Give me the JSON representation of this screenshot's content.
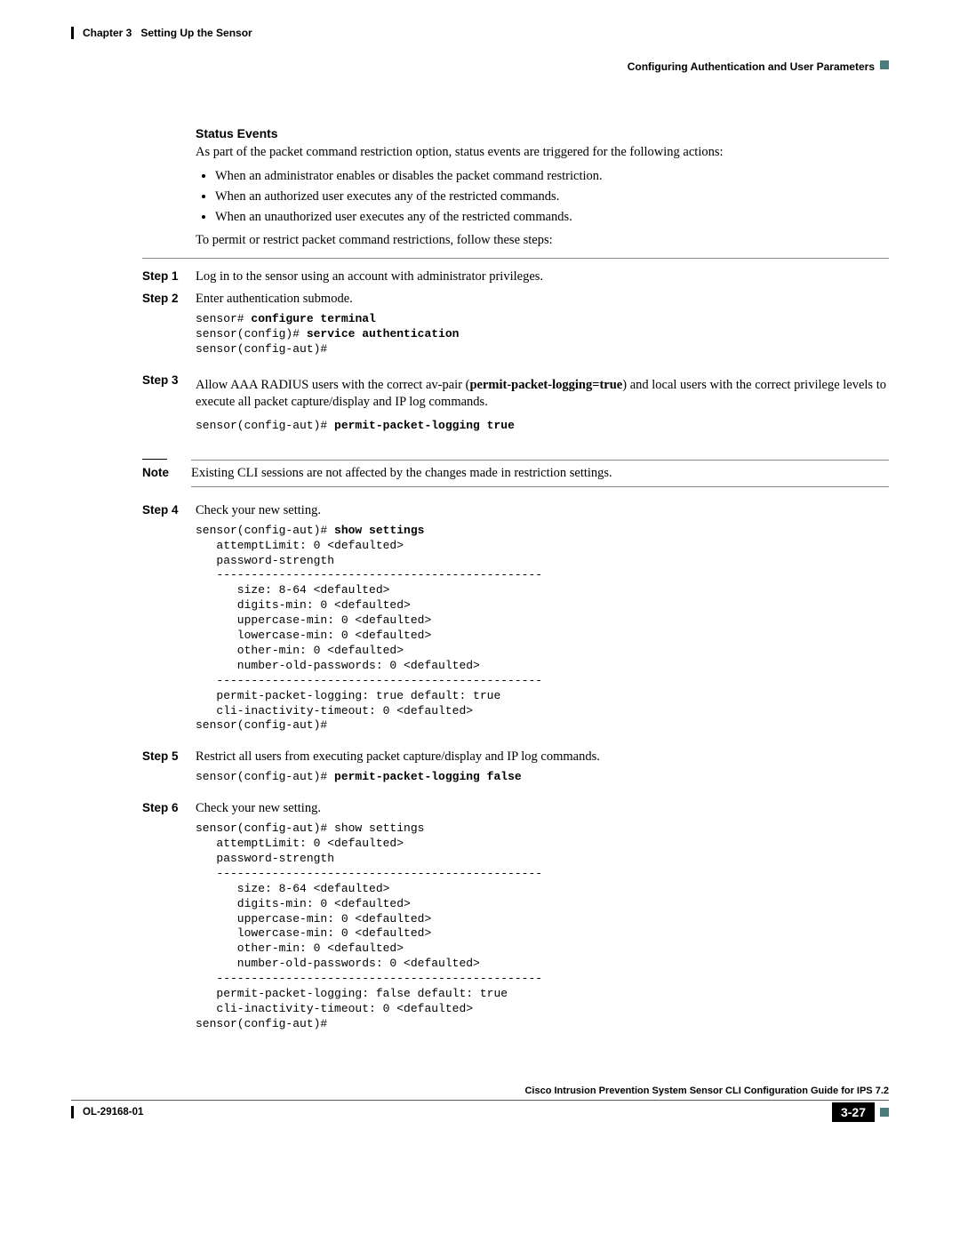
{
  "header": {
    "chapter": "Chapter 3",
    "title": "Setting Up the Sensor",
    "section": "Configuring Authentication and User Parameters"
  },
  "section": {
    "heading": "Status Events",
    "intro": "As part of the packet command restriction option, status events are triggered for the following actions:",
    "bullets": [
      "When an administrator enables or disables the packet command restriction.",
      "When an authorized user executes any of the restricted commands.",
      "When an unauthorized user executes any of the restricted commands."
    ],
    "lead": "To permit or restrict packet command restrictions, follow these steps:"
  },
  "steps": {
    "s1": {
      "label": "Step 1",
      "text": "Log in to the sensor using an account with administrator privileges."
    },
    "s2": {
      "label": "Step 2",
      "text": "Enter authentication submode.",
      "code": {
        "plain1": "sensor# ",
        "bold1": "configure terminal",
        "plain2": "\nsensor(config)# ",
        "bold2": "service authentication",
        "plain3": "\nsensor(config-aut)# "
      }
    },
    "s3": {
      "label": "Step 3",
      "text_pre": "Allow AAA RADIUS users with the correct av-pair (",
      "text_bold": "permit-packet-logging=true",
      "text_post": ") and local users with the correct privilege levels to execute all packet capture/display and IP log commands.",
      "code": {
        "plain1": "sensor(config-aut)# ",
        "bold1": "permit-packet-logging true"
      }
    },
    "note": {
      "label": "Note",
      "text": "Existing CLI sessions are not affected by the changes made in restriction settings."
    },
    "s4": {
      "label": "Step 4",
      "text": "Check your new setting.",
      "code": {
        "plain1": "sensor(config-aut)# ",
        "bold1": "show settings",
        "plain2": "\n   attemptLimit: 0 <defaulted>\n   password-strength\n   -----------------------------------------------\n      size: 8-64 <defaulted>\n      digits-min: 0 <defaulted>\n      uppercase-min: 0 <defaulted>\n      lowercase-min: 0 <defaulted>\n      other-min: 0 <defaulted>\n      number-old-passwords: 0 <defaulted>\n   -----------------------------------------------\n   permit-packet-logging: true default: true\n   cli-inactivity-timeout: 0 <defaulted>\nsensor(config-aut)# "
      }
    },
    "s5": {
      "label": "Step 5",
      "text": "Restrict all users from executing packet capture/display and IP log commands.",
      "code": {
        "plain1": "sensor(config-aut)# ",
        "bold1": "permit-packet-logging false"
      }
    },
    "s6": {
      "label": "Step 6",
      "text": "Check your new setting.",
      "code": {
        "plain1": "sensor(config-aut)# show settings\n   attemptLimit: 0 <defaulted>\n   password-strength\n   -----------------------------------------------\n      size: 8-64 <defaulted>\n      digits-min: 0 <defaulted>\n      uppercase-min: 0 <defaulted>\n      lowercase-min: 0 <defaulted>\n      other-min: 0 <defaulted>\n      number-old-passwords: 0 <defaulted>\n   -----------------------------------------------\n   permit-packet-logging: false default: true\n   cli-inactivity-timeout: 0 <defaulted>\nsensor(config-aut)# "
      }
    }
  },
  "footer": {
    "doc_title": "Cisco Intrusion Prevention System Sensor CLI Configuration Guide for IPS 7.2",
    "doc_id": "OL-29168-01",
    "page": "3-27"
  }
}
